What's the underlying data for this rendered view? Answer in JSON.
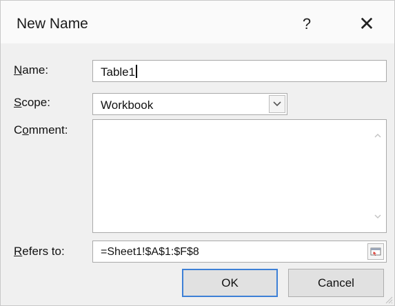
{
  "dialog": {
    "title": "New Name",
    "help_glyph": "?",
    "close_glyph": "✕"
  },
  "fields": {
    "name_label": "Name:",
    "name_value": "Table1",
    "scope_label": "Scope:",
    "scope_value": "Workbook",
    "comment_label": "Comment:",
    "comment_value": "",
    "refers_label": "Refers to:",
    "refers_value": "=Sheet1!$A$1:$F$8"
  },
  "buttons": {
    "ok_label": "OK",
    "cancel_label": "Cancel"
  },
  "colors": {
    "default_button_border": "#3c7fd6",
    "collapse_icon_accent": "#d9342b"
  }
}
